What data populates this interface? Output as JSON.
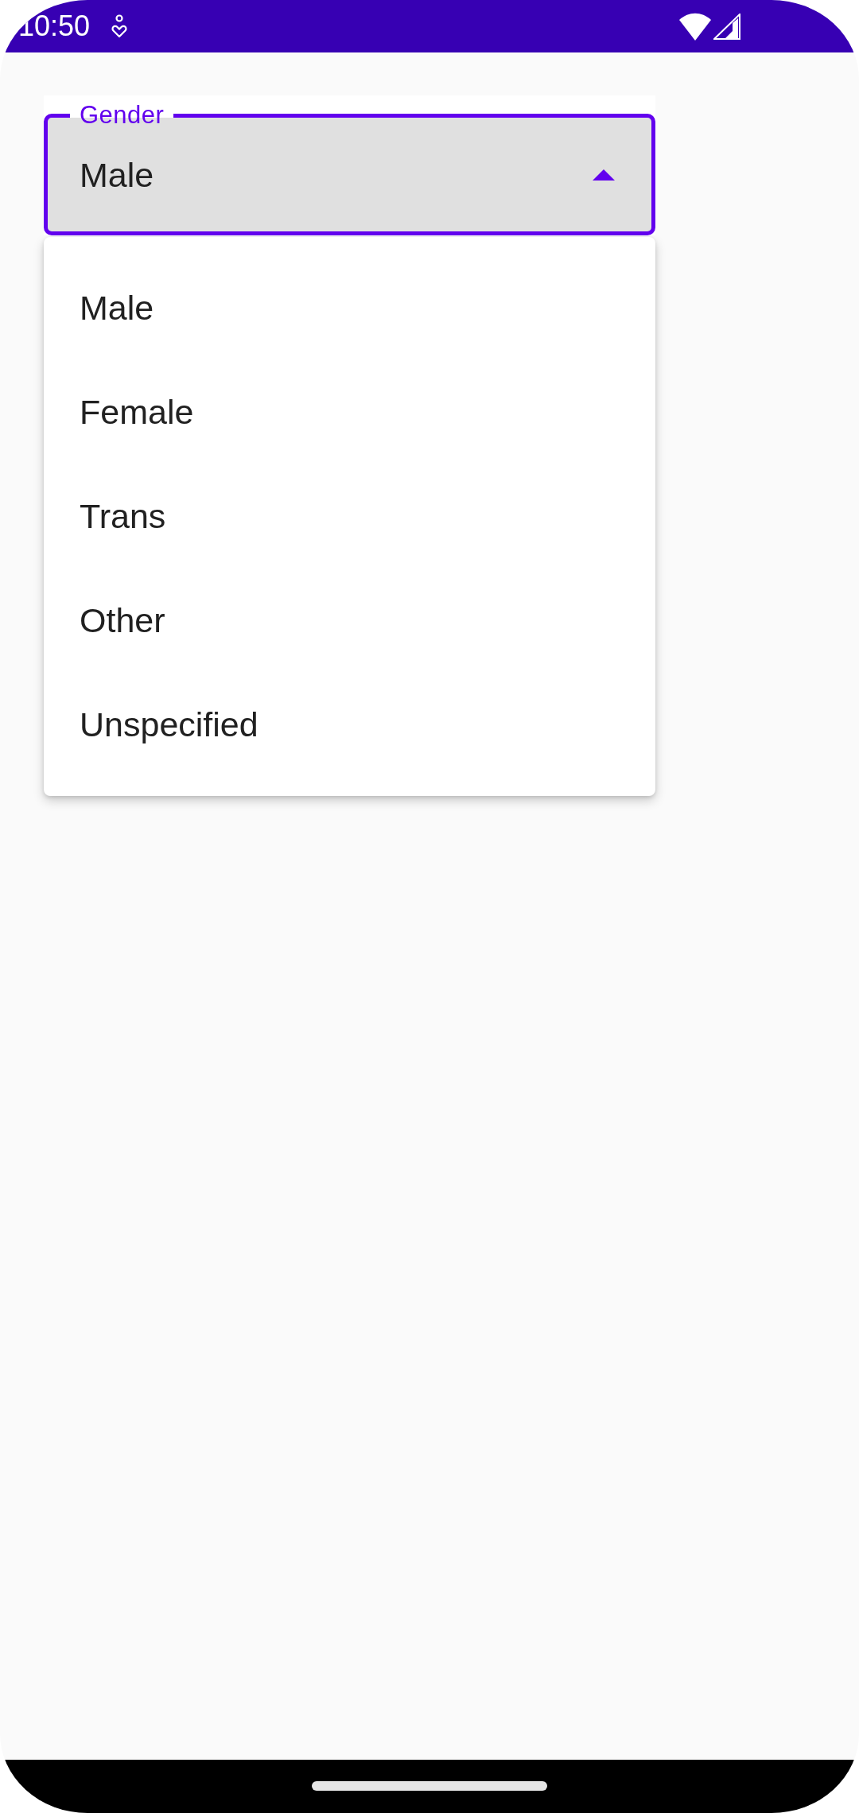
{
  "status_bar": {
    "time": "10:50"
  },
  "field": {
    "label": "Gender",
    "value": "Male",
    "focused": true,
    "expanded": true
  },
  "menu": {
    "items": [
      {
        "label": "Male",
        "selected": false
      },
      {
        "label": "Female",
        "selected": false
      },
      {
        "label": "Trans",
        "selected": false
      },
      {
        "label": "Other",
        "selected": false
      },
      {
        "label": "Unspecified",
        "selected": false
      }
    ]
  }
}
